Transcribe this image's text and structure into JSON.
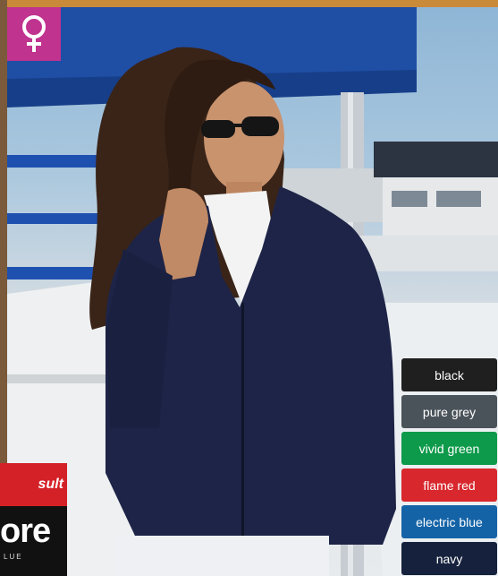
{
  "badge": {
    "icon": "female-symbol-icon",
    "color": "#c0338f"
  },
  "swatches": [
    {
      "label": "black",
      "color": "#1f1f1f"
    },
    {
      "label": "pure grey",
      "color": "#4b535a"
    },
    {
      "label": "vivid green",
      "color": "#0d9a4a"
    },
    {
      "label": "flame red",
      "color": "#d8272d"
    },
    {
      "label": "electric blue",
      "color": "#1563a7"
    },
    {
      "label": "navy",
      "color": "#16223d"
    }
  ],
  "brand": {
    "top_text": "sult",
    "wordmark": "ore",
    "tagline": "LUE"
  }
}
